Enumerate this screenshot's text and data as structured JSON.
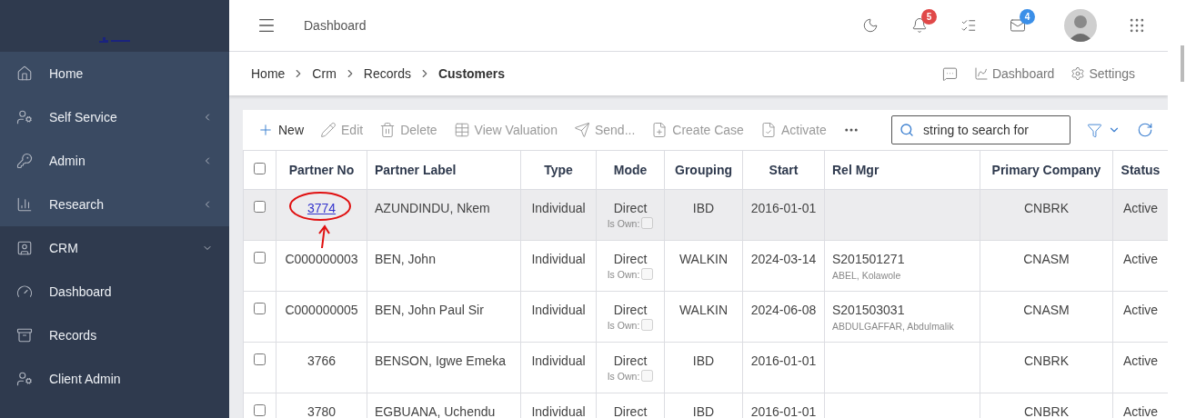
{
  "sidebar": {
    "items": [
      {
        "label": "Home",
        "highlighted": true
      },
      {
        "label": "Self Service",
        "highlighted": true,
        "expanded": false
      },
      {
        "label": "Admin",
        "highlighted": true,
        "expanded": false
      },
      {
        "label": "Research",
        "highlighted": true,
        "expanded": false
      },
      {
        "label": "CRM",
        "highlighted": false,
        "expanded": true,
        "children": [
          {
            "label": "Dashboard",
            "highlighted": false
          },
          {
            "label": "Records",
            "highlighted": false
          },
          {
            "label": "Client Admin",
            "highlighted": false
          }
        ]
      }
    ]
  },
  "header": {
    "title": "Dashboard",
    "notifications_badge": "5",
    "messages_badge": "4"
  },
  "breadcrumb": [
    {
      "label": "Home",
      "current": false
    },
    {
      "label": "Crm",
      "current": false
    },
    {
      "label": "Records",
      "current": false
    },
    {
      "label": "Customers",
      "current": true
    }
  ],
  "page_actions": [
    "Dashboard",
    "Settings"
  ],
  "toolbar": {
    "actions": [
      {
        "label": "New",
        "disabled": false
      },
      {
        "label": "Edit",
        "disabled": true
      },
      {
        "label": "Delete",
        "disabled": true
      },
      {
        "label": "View Valuation",
        "disabled": true
      },
      {
        "label": "Send...",
        "disabled": true
      },
      {
        "label": "Create Case",
        "disabled": true
      },
      {
        "label": "Activate",
        "disabled": true
      }
    ],
    "search": {
      "placeholder": "string to search for"
    }
  },
  "table": {
    "select_all_checked": false,
    "columns": [
      "Partner No",
      "Partner Label",
      "Type",
      "Mode",
      "Grouping",
      "Start",
      "Rel Mgr",
      "Primary Company",
      "Status"
    ],
    "rows": [
      {
        "highlighted": true,
        "checked": false,
        "partner_no": "3774",
        "partner_no_link": true,
        "partner_label": "AZUNDINDU, Nkem",
        "type": "Individual",
        "mode": "Direct",
        "is_own_label": "Is Own:",
        "is_own": false,
        "grouping": "IBD",
        "start": "2016-01-01",
        "primary_company": "CNBRK",
        "status": "Active"
      },
      {
        "highlighted": false,
        "checked": false,
        "partner_no": "C000000003",
        "partner_no_link": false,
        "partner_label": "BEN, John",
        "type": "Individual",
        "mode": "Direct",
        "is_own_label": "Is Own:",
        "is_own": false,
        "grouping": "WALKIN",
        "start": "2024-03-14",
        "rel_mgr": "S201501271",
        "rel_mgr_name": "ABEL, Kolawole",
        "primary_company": "CNASM",
        "status": "Active"
      },
      {
        "highlighted": false,
        "checked": false,
        "partner_no": "C000000005",
        "partner_no_link": false,
        "partner_label": "BEN, John Paul Sir",
        "type": "Individual",
        "mode": "Direct",
        "is_own_label": "Is Own:",
        "is_own": false,
        "grouping": "WALKIN",
        "start": "2024-06-08",
        "rel_mgr": "S201503031",
        "rel_mgr_name": "ABDULGAFFAR, Abdulmalik",
        "primary_company": "CNASM",
        "status": "Active"
      },
      {
        "highlighted": false,
        "checked": false,
        "partner_no": "3766",
        "partner_no_link": false,
        "partner_label": "BENSON, Igwe Emeka",
        "type": "Individual",
        "mode": "Direct",
        "is_own_label": "Is Own:",
        "is_own": false,
        "grouping": "IBD",
        "start": "2016-01-01",
        "primary_company": "CNBRK",
        "status": "Active"
      },
      {
        "highlighted": false,
        "checked": false,
        "partner_no": "3780",
        "partner_no_link": false,
        "partner_label": "EGBUANA, Uchendu",
        "type": "Individual",
        "mode": "Direct",
        "grouping": "IBD",
        "start": "2016-01-01",
        "primary_company": "CNBRK",
        "status": "Active"
      }
    ]
  }
}
